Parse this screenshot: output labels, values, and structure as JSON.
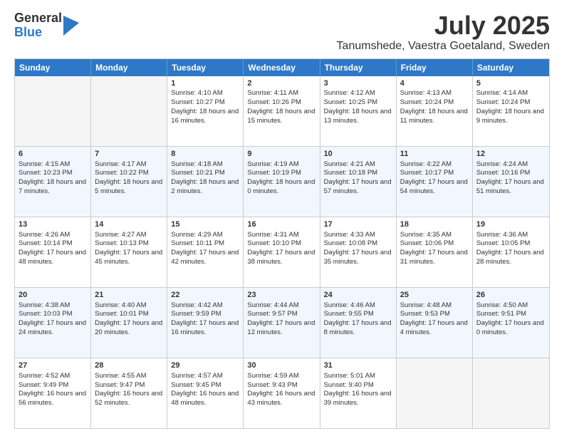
{
  "logo": {
    "general": "General",
    "blue": "Blue"
  },
  "title": "July 2025",
  "location": "Tanumshede, Vaestra Goetaland, Sweden",
  "days": [
    "Sunday",
    "Monday",
    "Tuesday",
    "Wednesday",
    "Thursday",
    "Friday",
    "Saturday"
  ],
  "weeks": [
    [
      {
        "day": "",
        "content": ""
      },
      {
        "day": "",
        "content": ""
      },
      {
        "day": "1",
        "content": "Sunrise: 4:10 AM\nSunset: 10:27 PM\nDaylight: 18 hours and 16 minutes."
      },
      {
        "day": "2",
        "content": "Sunrise: 4:11 AM\nSunset: 10:26 PM\nDaylight: 18 hours and 15 minutes."
      },
      {
        "day": "3",
        "content": "Sunrise: 4:12 AM\nSunset: 10:25 PM\nDaylight: 18 hours and 13 minutes."
      },
      {
        "day": "4",
        "content": "Sunrise: 4:13 AM\nSunset: 10:24 PM\nDaylight: 18 hours and 11 minutes."
      },
      {
        "day": "5",
        "content": "Sunrise: 4:14 AM\nSunset: 10:24 PM\nDaylight: 18 hours and 9 minutes."
      }
    ],
    [
      {
        "day": "6",
        "content": "Sunrise: 4:15 AM\nSunset: 10:23 PM\nDaylight: 18 hours and 7 minutes."
      },
      {
        "day": "7",
        "content": "Sunrise: 4:17 AM\nSunset: 10:22 PM\nDaylight: 18 hours and 5 minutes."
      },
      {
        "day": "8",
        "content": "Sunrise: 4:18 AM\nSunset: 10:21 PM\nDaylight: 18 hours and 2 minutes."
      },
      {
        "day": "9",
        "content": "Sunrise: 4:19 AM\nSunset: 10:19 PM\nDaylight: 18 hours and 0 minutes."
      },
      {
        "day": "10",
        "content": "Sunrise: 4:21 AM\nSunset: 10:18 PM\nDaylight: 17 hours and 57 minutes."
      },
      {
        "day": "11",
        "content": "Sunrise: 4:22 AM\nSunset: 10:17 PM\nDaylight: 17 hours and 54 minutes."
      },
      {
        "day": "12",
        "content": "Sunrise: 4:24 AM\nSunset: 10:16 PM\nDaylight: 17 hours and 51 minutes."
      }
    ],
    [
      {
        "day": "13",
        "content": "Sunrise: 4:26 AM\nSunset: 10:14 PM\nDaylight: 17 hours and 48 minutes."
      },
      {
        "day": "14",
        "content": "Sunrise: 4:27 AM\nSunset: 10:13 PM\nDaylight: 17 hours and 45 minutes."
      },
      {
        "day": "15",
        "content": "Sunrise: 4:29 AM\nSunset: 10:11 PM\nDaylight: 17 hours and 42 minutes."
      },
      {
        "day": "16",
        "content": "Sunrise: 4:31 AM\nSunset: 10:10 PM\nDaylight: 17 hours and 38 minutes."
      },
      {
        "day": "17",
        "content": "Sunrise: 4:33 AM\nSunset: 10:08 PM\nDaylight: 17 hours and 35 minutes."
      },
      {
        "day": "18",
        "content": "Sunrise: 4:35 AM\nSunset: 10:06 PM\nDaylight: 17 hours and 31 minutes."
      },
      {
        "day": "19",
        "content": "Sunrise: 4:36 AM\nSunset: 10:05 PM\nDaylight: 17 hours and 28 minutes."
      }
    ],
    [
      {
        "day": "20",
        "content": "Sunrise: 4:38 AM\nSunset: 10:03 PM\nDaylight: 17 hours and 24 minutes."
      },
      {
        "day": "21",
        "content": "Sunrise: 4:40 AM\nSunset: 10:01 PM\nDaylight: 17 hours and 20 minutes."
      },
      {
        "day": "22",
        "content": "Sunrise: 4:42 AM\nSunset: 9:59 PM\nDaylight: 17 hours and 16 minutes."
      },
      {
        "day": "23",
        "content": "Sunrise: 4:44 AM\nSunset: 9:57 PM\nDaylight: 17 hours and 12 minutes."
      },
      {
        "day": "24",
        "content": "Sunrise: 4:46 AM\nSunset: 9:55 PM\nDaylight: 17 hours and 8 minutes."
      },
      {
        "day": "25",
        "content": "Sunrise: 4:48 AM\nSunset: 9:53 PM\nDaylight: 17 hours and 4 minutes."
      },
      {
        "day": "26",
        "content": "Sunrise: 4:50 AM\nSunset: 9:51 PM\nDaylight: 17 hours and 0 minutes."
      }
    ],
    [
      {
        "day": "27",
        "content": "Sunrise: 4:52 AM\nSunset: 9:49 PM\nDaylight: 16 hours and 56 minutes."
      },
      {
        "day": "28",
        "content": "Sunrise: 4:55 AM\nSunset: 9:47 PM\nDaylight: 16 hours and 52 minutes."
      },
      {
        "day": "29",
        "content": "Sunrise: 4:57 AM\nSunset: 9:45 PM\nDaylight: 16 hours and 48 minutes."
      },
      {
        "day": "30",
        "content": "Sunrise: 4:59 AM\nSunset: 9:43 PM\nDaylight: 16 hours and 43 minutes."
      },
      {
        "day": "31",
        "content": "Sunrise: 5:01 AM\nSunset: 9:40 PM\nDaylight: 16 hours and 39 minutes."
      },
      {
        "day": "",
        "content": ""
      },
      {
        "day": "",
        "content": ""
      }
    ]
  ]
}
